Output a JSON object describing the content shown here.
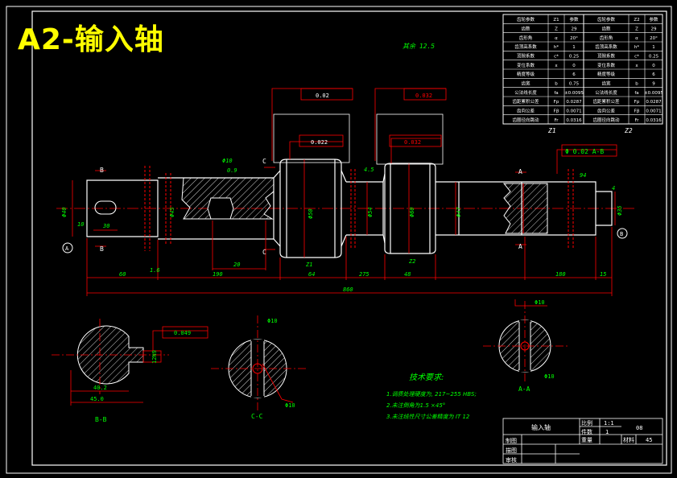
{
  "document": {
    "big_title": "A2-输入轴"
  },
  "params_table": {
    "rows": [
      [
        "齿轮参数",
        "Z1",
        "参数",
        "齿轮参数",
        "Z2",
        "参数"
      ],
      [
        "齿数",
        "Z",
        "29",
        "齿数",
        "Z",
        "29"
      ],
      [
        "齿形角",
        "α",
        "20°",
        "齿形角",
        "α",
        "20°"
      ],
      [
        "齿顶高系数",
        "h*",
        "1",
        "齿顶高系数",
        "h*",
        "1"
      ],
      [
        "顶隙系数",
        "c*",
        "0.25",
        "顶隙系数",
        "c*",
        "0.25"
      ],
      [
        "变位系数",
        "x",
        "0",
        "变位系数",
        "x",
        "0"
      ],
      [
        "精度等级",
        "",
        "6",
        "精度等级",
        "",
        "6"
      ],
      [
        "齿宽",
        "b",
        "0.75",
        "齿宽",
        "b",
        "9"
      ],
      [
        "公法线长度",
        "fa",
        "±0.0095",
        "公法线长度",
        "fa",
        "±0.0095"
      ],
      [
        "齿距累积公差",
        "Fp",
        "0.0287",
        "齿距累积公差",
        "Fp",
        "0.0287"
      ],
      [
        "齿向公差",
        "Fβ",
        "0.0071",
        "齿向公差",
        "Fβ",
        "0.0071"
      ],
      [
        "齿圈径向跳动",
        "Fr",
        "0.0316",
        "齿圈径向跳动",
        "Fr",
        "0.0316"
      ]
    ],
    "col_labels": [
      "Z1",
      "Z2"
    ]
  },
  "drawing": {
    "roughness_note": "其余 12.5",
    "gdt": {
      "top_left": "0.02",
      "top_right": "0.032",
      "gear1": "0.022",
      "gear2": "0.032",
      "right": "Φ 0.02  A-B"
    },
    "section_labels": {
      "b": "B",
      "c": "C",
      "a": "A"
    },
    "datum_a": "A",
    "datum_b": "B",
    "dim_labels": {
      "key_len": "30",
      "key_w": "10",
      "d_left": "Φ40",
      "d_left2": "Φ45",
      "dia1": "Φ50",
      "len1": "20",
      "d_gear1": "Φ60",
      "d_mid": "Φ54",
      "d_gear2": "Φ60",
      "d_r1": "Φ47",
      "d_right": "Φ35",
      "seg1": "60",
      "seg2": "190",
      "seg3": "64",
      "seg4": "275",
      "seg5": "48",
      "seg6": "180",
      "seg7": "15",
      "total": "860",
      "z1": "Z1",
      "z2": "Z2",
      "r_top": "Φ10",
      "r_top2": "0.9",
      "chamfer": "4.5",
      "r_small": "1.6",
      "f94": "94",
      "f4": "4"
    }
  },
  "sections": {
    "bb": {
      "label": "B-B",
      "dim_w": "45.0",
      "dim_k": "40.2",
      "dim_h": "12N9",
      "tol": "0.049"
    },
    "cc": {
      "label": "C-C",
      "dia_top": "Φ10",
      "dia_bot": "Φ10"
    },
    "aa": {
      "label": "A-A",
      "dia_top": "Φ10",
      "dia_bot": "Φ10"
    }
  },
  "tech_notes": {
    "title": "技术要求:",
    "items": [
      "1.调质处理硬度为, 217~255 HBS;",
      "2.未注倒角为1.5 ×45°",
      "3.未注线性尺寸公差精度为 IT 12"
    ]
  },
  "title_block": {
    "part_name": "输入轴",
    "scale_label": "比例",
    "scale": "1:1",
    "qty_label": "件数",
    "qty": "1",
    "weight_label": "重量",
    "material_label": "材料",
    "material": "45",
    "drawing_no": "08",
    "rows": [
      "制图",
      "描图",
      "审核"
    ]
  },
  "colors": {
    "background": "#000000",
    "outline": "#ffffff",
    "dimension": "#ff0000",
    "text": "#00ff00",
    "title": "#ffff00",
    "centerline": "#ff0000",
    "hatch": "#ffffff"
  }
}
